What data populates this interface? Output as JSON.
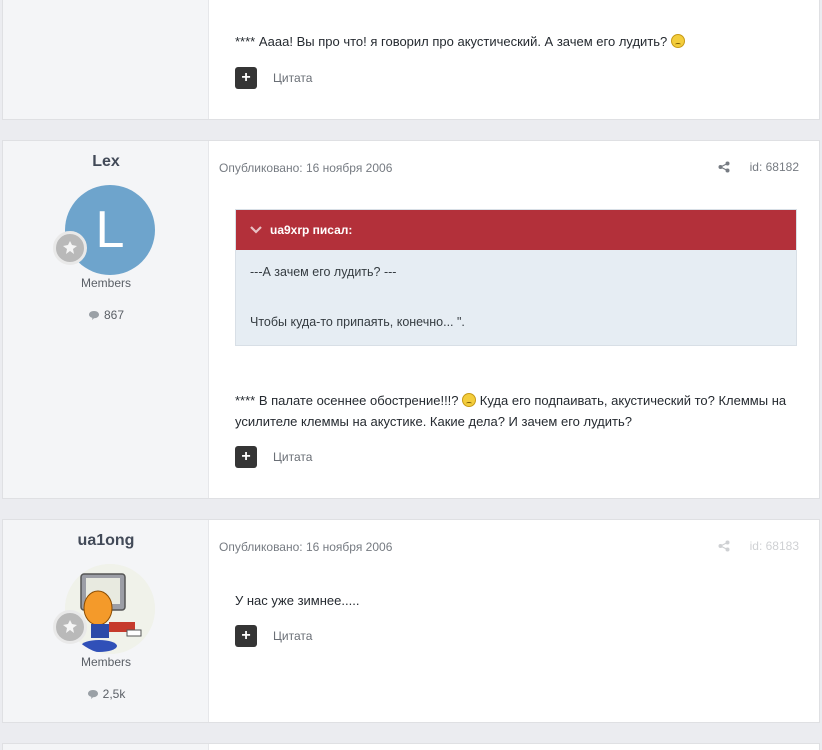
{
  "posts": [
    {
      "text": "**** Аааа! Вы про что! я говорил про акустический. А зачем его лудить?",
      "quote_label": "Цитата"
    },
    {
      "author": "Lex",
      "avatar_letter": "L",
      "avatar_color": "#6ea4cc",
      "group": "Members",
      "post_count": "867",
      "date": "Опубликовано: 16 ноября 2006",
      "id_label": "id: 68182",
      "quote": {
        "header": "ua9xrp писал:",
        "lines": [
          "---А зачем его лудить? ---",
          "Чтобы куда-то припаять, конечно... \"."
        ]
      },
      "text_a": "**** В палате осеннее обострение!!!?",
      "text_b": "Куда его подпаивать, акустический то? Клеммы на",
      "text_c": "усилителе клеммы на акустике. Какие дела? И зачем его лудить?",
      "quote_label": "Цитата"
    },
    {
      "author": "ua1ong",
      "group": "Members",
      "post_count": "2,5k",
      "date": "Опубликовано: 16 ноября 2006",
      "id_label": "id: 68183",
      "text": "У нас уже зимнее.....",
      "quote_label": "Цитата"
    }
  ],
  "colors": {
    "quote_header": "#b3303a",
    "quote_bg": "#e6edf3",
    "page_bg": "#ebecf0"
  }
}
